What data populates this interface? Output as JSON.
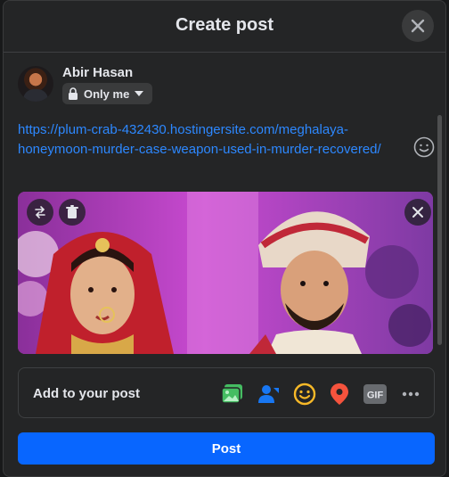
{
  "dialog": {
    "title": "Create post",
    "close_icon": "close-icon"
  },
  "user": {
    "name": "Abir Hasan",
    "privacy_label": "Only me",
    "privacy_icon": "lock-icon"
  },
  "composer": {
    "text": "https://plum-crab-432430.hostingersite.com/meghalaya-honeymoon-murder-case-weapon-used-in-murder-recovered/",
    "emoji_icon": "smiley-icon"
  },
  "preview": {
    "image": "wedding-photo",
    "buttons": [
      "swap-icon",
      "trash-icon",
      "close-icon"
    ]
  },
  "add_to_post": {
    "label": "Add to your post",
    "icons": [
      "photo-video-icon",
      "tag-people-icon",
      "feeling-icon",
      "location-icon",
      "gif-icon",
      "more-icon"
    ],
    "colors": {
      "photo": "#45bd62",
      "tag": "#1877f2",
      "feeling": "#f7b928",
      "location": "#f5533d",
      "gif": "#686b6f"
    },
    "gif_text": "GIF"
  },
  "actions": {
    "post_label": "Post",
    "post_color": "#0866ff"
  }
}
